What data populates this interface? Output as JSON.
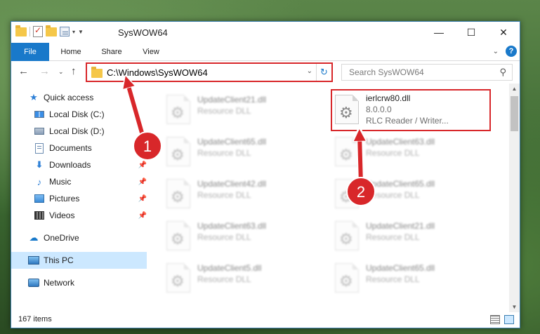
{
  "window": {
    "title": "SysWOW64",
    "controls": {
      "minimize": "—",
      "maximize": "☐",
      "close": "✕"
    }
  },
  "ribbon": {
    "tabs": [
      "File",
      "Home",
      "Share",
      "View"
    ],
    "help": "?"
  },
  "address": {
    "path": "C:\\Windows\\SysWOW64",
    "search_placeholder": "Search SysWOW64"
  },
  "nav": {
    "items": [
      {
        "label": "Quick access",
        "icon": "star-icon"
      },
      {
        "label": "Local Disk (C:)",
        "icon": "disk-icon"
      },
      {
        "label": "Local Disk (D:)",
        "icon": "disk-icon"
      },
      {
        "label": "Documents",
        "icon": "documents-icon",
        "pinned": true
      },
      {
        "label": "Downloads",
        "icon": "downloads-icon",
        "pinned": true
      },
      {
        "label": "Music",
        "icon": "music-icon",
        "pinned": true
      },
      {
        "label": "Pictures",
        "icon": "pictures-icon",
        "pinned": true
      },
      {
        "label": "Videos",
        "icon": "videos-icon",
        "pinned": true
      },
      {
        "label": "OneDrive",
        "icon": "onedrive-icon"
      },
      {
        "label": "This PC",
        "icon": "this-pc-icon",
        "selected": true
      },
      {
        "label": "Network",
        "icon": "network-icon"
      }
    ]
  },
  "files": {
    "left_column": [
      {
        "name": "UpdateClient21.dll",
        "type": "Resource DLL"
      },
      {
        "name": "UpdateClient65.dll",
        "type": "Resource DLL"
      },
      {
        "name": "UpdateClient42.dll",
        "type": "Resource DLL"
      },
      {
        "name": "UpdateClient63.dll",
        "type": "Resource DLL"
      },
      {
        "name": "UpdateClient5.dll",
        "type": "Resource DLL"
      }
    ],
    "right_column": [
      {
        "name": "UpdateClient63.dll",
        "type": "Resource DLL"
      },
      {
        "name": "UpdateClient65.dll",
        "type": "Resource DLL"
      },
      {
        "name": "UpdateClient21.dll",
        "type": "Resource DLL"
      },
      {
        "name": "UpdateClient65.dll",
        "type": "Resource DLL"
      }
    ],
    "highlighted": {
      "name": "ierlcrw80.dll",
      "version": "8.0.0.0",
      "description": "RLC Reader / Writer..."
    }
  },
  "status": {
    "item_count": "167 items"
  },
  "annotations": {
    "step1": "1",
    "step2": "2",
    "color": "#d8272a"
  }
}
